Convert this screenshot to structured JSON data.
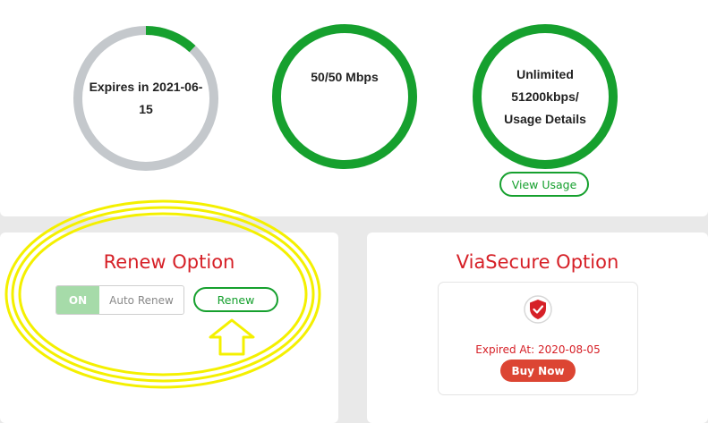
{
  "plan": {
    "expiry_text": "Expires in 2021-06-15",
    "expiry_progress": 0.12,
    "speed_text": "50/50 Mbps",
    "usage_line1": "Unlimited",
    "usage_line2": "51200kbps/",
    "usage_line3": "Usage Details",
    "view_usage_label": "View Usage"
  },
  "renew": {
    "title": "Renew Option",
    "toggle_state": "ON",
    "toggle_label": "Auto Renew",
    "renew_button_label": "Renew"
  },
  "viasecure": {
    "title": "ViaSecure Option",
    "shield_icon": "shield-check-icon",
    "expired_text": "Expired At: 2020-08-05",
    "buy_button_label": "Buy Now"
  },
  "colors": {
    "green": "#16a02e",
    "grey_ring": "#c4c8cc",
    "red": "#d62027",
    "buy": "#dc4533",
    "highlight": "#f4f000"
  }
}
